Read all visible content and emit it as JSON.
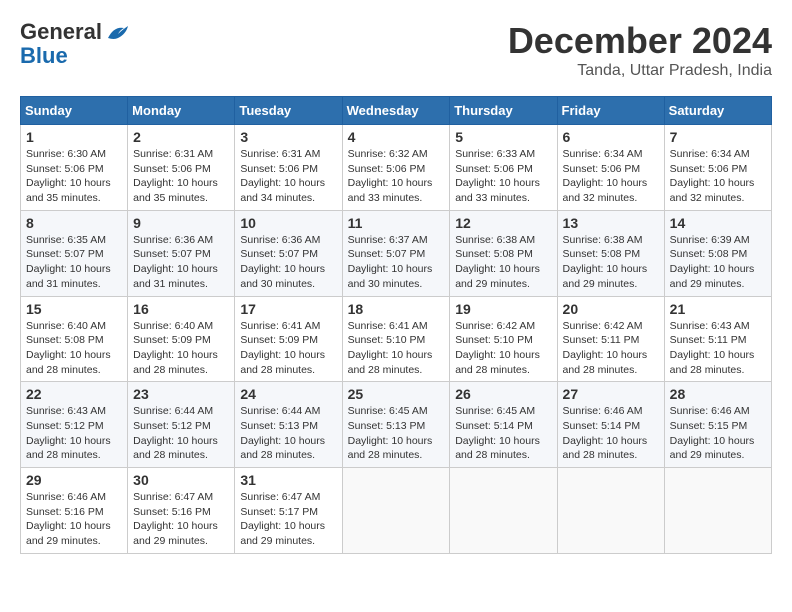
{
  "header": {
    "logo_line1": "General",
    "logo_line2": "Blue",
    "month_title": "December 2024",
    "location": "Tanda, Uttar Pradesh, India"
  },
  "weekdays": [
    "Sunday",
    "Monday",
    "Tuesday",
    "Wednesday",
    "Thursday",
    "Friday",
    "Saturday"
  ],
  "weeks": [
    [
      {
        "day": 1,
        "sunrise": "6:30 AM",
        "sunset": "5:06 PM",
        "daylight": "10 hours and 35 minutes."
      },
      {
        "day": 2,
        "sunrise": "6:31 AM",
        "sunset": "5:06 PM",
        "daylight": "10 hours and 35 minutes."
      },
      {
        "day": 3,
        "sunrise": "6:31 AM",
        "sunset": "5:06 PM",
        "daylight": "10 hours and 34 minutes."
      },
      {
        "day": 4,
        "sunrise": "6:32 AM",
        "sunset": "5:06 PM",
        "daylight": "10 hours and 33 minutes."
      },
      {
        "day": 5,
        "sunrise": "6:33 AM",
        "sunset": "5:06 PM",
        "daylight": "10 hours and 33 minutes."
      },
      {
        "day": 6,
        "sunrise": "6:34 AM",
        "sunset": "5:06 PM",
        "daylight": "10 hours and 32 minutes."
      },
      {
        "day": 7,
        "sunrise": "6:34 AM",
        "sunset": "5:06 PM",
        "daylight": "10 hours and 32 minutes."
      }
    ],
    [
      {
        "day": 8,
        "sunrise": "6:35 AM",
        "sunset": "5:07 PM",
        "daylight": "10 hours and 31 minutes."
      },
      {
        "day": 9,
        "sunrise": "6:36 AM",
        "sunset": "5:07 PM",
        "daylight": "10 hours and 31 minutes."
      },
      {
        "day": 10,
        "sunrise": "6:36 AM",
        "sunset": "5:07 PM",
        "daylight": "10 hours and 30 minutes."
      },
      {
        "day": 11,
        "sunrise": "6:37 AM",
        "sunset": "5:07 PM",
        "daylight": "10 hours and 30 minutes."
      },
      {
        "day": 12,
        "sunrise": "6:38 AM",
        "sunset": "5:08 PM",
        "daylight": "10 hours and 29 minutes."
      },
      {
        "day": 13,
        "sunrise": "6:38 AM",
        "sunset": "5:08 PM",
        "daylight": "10 hours and 29 minutes."
      },
      {
        "day": 14,
        "sunrise": "6:39 AM",
        "sunset": "5:08 PM",
        "daylight": "10 hours and 29 minutes."
      }
    ],
    [
      {
        "day": 15,
        "sunrise": "6:40 AM",
        "sunset": "5:08 PM",
        "daylight": "10 hours and 28 minutes."
      },
      {
        "day": 16,
        "sunrise": "6:40 AM",
        "sunset": "5:09 PM",
        "daylight": "10 hours and 28 minutes."
      },
      {
        "day": 17,
        "sunrise": "6:41 AM",
        "sunset": "5:09 PM",
        "daylight": "10 hours and 28 minutes."
      },
      {
        "day": 18,
        "sunrise": "6:41 AM",
        "sunset": "5:10 PM",
        "daylight": "10 hours and 28 minutes."
      },
      {
        "day": 19,
        "sunrise": "6:42 AM",
        "sunset": "5:10 PM",
        "daylight": "10 hours and 28 minutes."
      },
      {
        "day": 20,
        "sunrise": "6:42 AM",
        "sunset": "5:11 PM",
        "daylight": "10 hours and 28 minutes."
      },
      {
        "day": 21,
        "sunrise": "6:43 AM",
        "sunset": "5:11 PM",
        "daylight": "10 hours and 28 minutes."
      }
    ],
    [
      {
        "day": 22,
        "sunrise": "6:43 AM",
        "sunset": "5:12 PM",
        "daylight": "10 hours and 28 minutes."
      },
      {
        "day": 23,
        "sunrise": "6:44 AM",
        "sunset": "5:12 PM",
        "daylight": "10 hours and 28 minutes."
      },
      {
        "day": 24,
        "sunrise": "6:44 AM",
        "sunset": "5:13 PM",
        "daylight": "10 hours and 28 minutes."
      },
      {
        "day": 25,
        "sunrise": "6:45 AM",
        "sunset": "5:13 PM",
        "daylight": "10 hours and 28 minutes."
      },
      {
        "day": 26,
        "sunrise": "6:45 AM",
        "sunset": "5:14 PM",
        "daylight": "10 hours and 28 minutes."
      },
      {
        "day": 27,
        "sunrise": "6:46 AM",
        "sunset": "5:14 PM",
        "daylight": "10 hours and 28 minutes."
      },
      {
        "day": 28,
        "sunrise": "6:46 AM",
        "sunset": "5:15 PM",
        "daylight": "10 hours and 29 minutes."
      }
    ],
    [
      {
        "day": 29,
        "sunrise": "6:46 AM",
        "sunset": "5:16 PM",
        "daylight": "10 hours and 29 minutes."
      },
      {
        "day": 30,
        "sunrise": "6:47 AM",
        "sunset": "5:16 PM",
        "daylight": "10 hours and 29 minutes."
      },
      {
        "day": 31,
        "sunrise": "6:47 AM",
        "sunset": "5:17 PM",
        "daylight": "10 hours and 29 minutes."
      },
      null,
      null,
      null,
      null
    ]
  ]
}
